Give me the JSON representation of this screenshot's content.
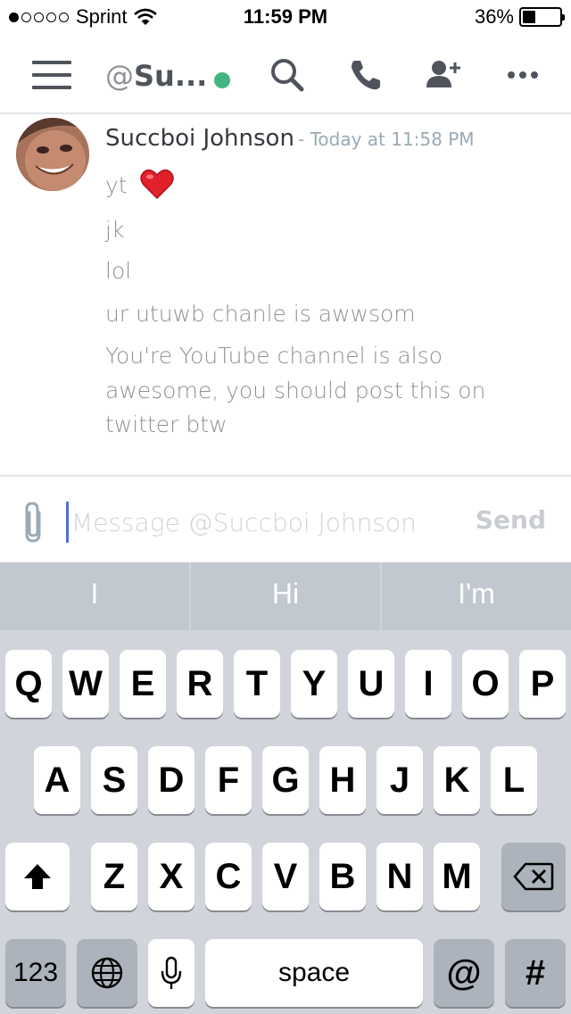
{
  "status_bar": {
    "carrier": "Sprint",
    "time": "11:59 PM",
    "battery": "36%",
    "battery_level": 0.36,
    "signal_bars": 1
  },
  "header": {
    "at_prefix": "@",
    "channel_name": "Su...",
    "status": "online",
    "status_color": "#43b581",
    "icons": [
      "menu-icon",
      "search-icon",
      "phone-icon",
      "add-user-icon",
      "more-icon"
    ]
  },
  "message": {
    "author": "Succboi Johnson",
    "timestamp": "- Today at 11:58 PM",
    "lines": [
      "yt",
      "jk",
      "lol",
      "ur utuwb chanle is awwsom",
      "You're YouTube channel is also",
      "awesome, you should post this on",
      "twitter btw"
    ],
    "reaction_emoji": "heart-emoji"
  },
  "composer": {
    "placeholder": "Message @Succboi Johnson",
    "value": "",
    "send_label": "Send"
  },
  "keyboard": {
    "suggestions": [
      "I",
      "Hi",
      "I'm"
    ],
    "row1": [
      "Q",
      "W",
      "E",
      "R",
      "T",
      "Y",
      "U",
      "I",
      "O",
      "P"
    ],
    "row2": [
      "A",
      "S",
      "D",
      "F",
      "G",
      "H",
      "J",
      "K",
      "L"
    ],
    "row3": [
      "Z",
      "X",
      "C",
      "V",
      "B",
      "N",
      "M"
    ],
    "numbers_label": "123",
    "space_label": "space",
    "at_label": "@",
    "hash_label": "#"
  }
}
